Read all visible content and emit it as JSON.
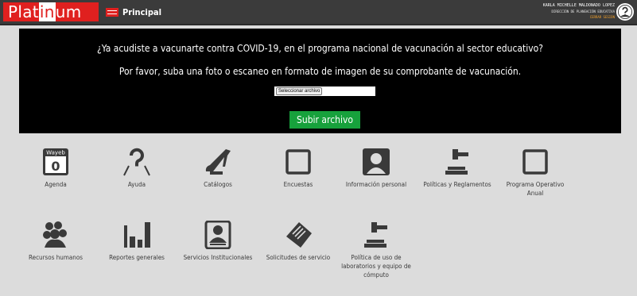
{
  "header": {
    "logo": {
      "pre": "Plat",
      "mid": "in",
      "post": "um"
    },
    "menu_label": "Principal",
    "user_name": "KARLA MICHELLE MALDONADO LOPEZ",
    "department": "DIRECCIÓN DE PLANEACIÓN EDUCATIVA",
    "logout": "CERRAR SESIÓN"
  },
  "banner": {
    "question": "¿Ya acudiste a vacunarte contra COVID-19, en el programa nacional de vacunación al sector educativo?",
    "instruction": "Por favor, suba una foto o escaneo en formato de imagen de su comprobante de vacunación.",
    "file_button": "Seleccionar archivo",
    "submit_label": "Subir archivo"
  },
  "tiles": [
    {
      "label": "Agenda",
      "icon": "calendar-icon",
      "badge": "Wayeb",
      "number": "0"
    },
    {
      "label": "Ayuda",
      "icon": "question-icon"
    },
    {
      "label": "Catálogos",
      "icon": "high-heel-icon"
    },
    {
      "label": "Encuestas",
      "icon": "square-icon"
    },
    {
      "label": "Información personal",
      "icon": "person-icon"
    },
    {
      "label": "Políticas y Reglamentos",
      "icon": "gavel-icon"
    },
    {
      "label": "Programa Operativo Anual",
      "icon": "square-icon"
    },
    {
      "label": "Recursos humanos",
      "icon": "people-icon"
    },
    {
      "label": "Reportes generales",
      "icon": "bar-chart-icon"
    },
    {
      "label": "Servicios Institucionales",
      "icon": "id-card-icon"
    },
    {
      "label": "Solicitudes de servicio",
      "icon": "document-icon"
    },
    {
      "label": "Política de uso de laboratorios y equipo de cómputo",
      "icon": "gavel-icon"
    }
  ],
  "colors": {
    "brand": "#e0201f",
    "topbar": "#3b3b3b",
    "submit": "#17a13c",
    "icon": "#3a3a3a",
    "background": "#dcdcdc"
  }
}
